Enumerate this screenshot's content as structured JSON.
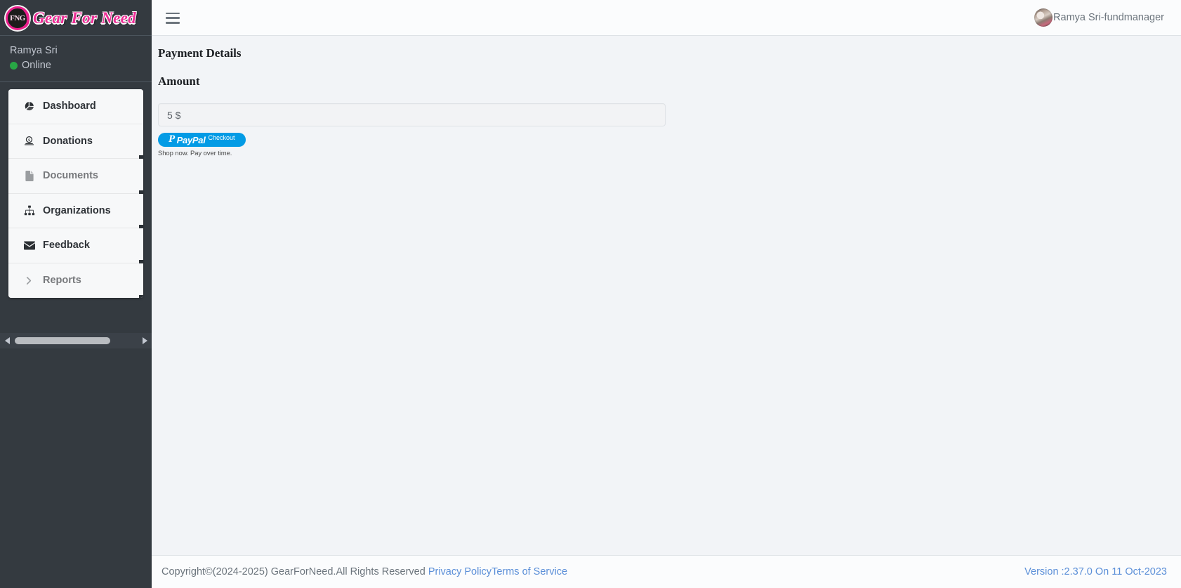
{
  "brand": {
    "badge_text": "FNG",
    "name": "Gear For Need",
    "accent_color": "#ec2e96"
  },
  "sidebar": {
    "user": {
      "name": "Ramya Sri",
      "status": "Online",
      "status_color": "#28a745"
    },
    "items": [
      {
        "label": "Dashboard",
        "icon": "pie-chart-icon",
        "muted": false
      },
      {
        "label": "Donations",
        "icon": "donation-icon",
        "muted": false
      },
      {
        "label": "Documents",
        "icon": "document-icon",
        "muted": true
      },
      {
        "label": "Organizations",
        "icon": "sitemap-icon",
        "muted": false
      },
      {
        "label": "Feedback",
        "icon": "envelope-icon",
        "muted": false
      },
      {
        "label": "Reports",
        "icon": "chevron-right-icon",
        "muted": true
      }
    ],
    "scrollbar": {
      "left_arrow": "◀",
      "right_arrow": "▶"
    }
  },
  "topbar": {
    "menu_icon": "hamburger-icon",
    "username": "Ramya Sri-fundmanager"
  },
  "main": {
    "page_title": "Payment Details",
    "section_title": "Amount",
    "amount": {
      "value": "5 $",
      "placeholder": "5 $"
    },
    "paypal": {
      "mark": "P",
      "word": "PayPal",
      "checkout_label": "Checkout",
      "tagline": "Shop now. Pay over time.",
      "button_color": "#039be5"
    }
  },
  "footer": {
    "copyright": "Copyright©(2024-2025) GearForNeed.All Rights Reserved ",
    "privacy_policy": "Privacy Policy",
    "terms_of_service": "Terms of Service",
    "version": "Version :2.37.0 On 11 Oct-2023",
    "link_color": "#5b8fd8"
  }
}
